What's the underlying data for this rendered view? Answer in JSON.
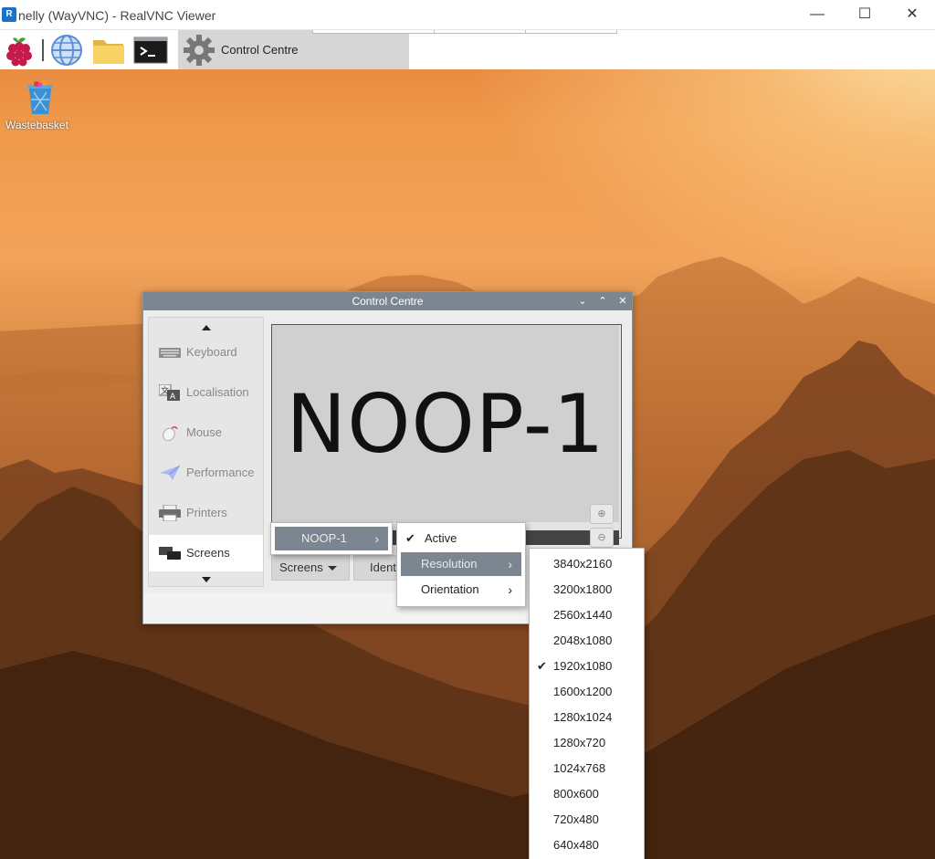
{
  "vnc_window": {
    "logo_text": "R",
    "title": "nelly (WayVNC) - RealVNC Viewer",
    "minimize_glyph": "—",
    "maximize_glyph": "☐",
    "close_glyph": "✕"
  },
  "taskbar": {
    "items": [
      {
        "name": "raspberry-menu",
        "icon": "raspberry-pi-icon"
      },
      {
        "name": "web-browser",
        "icon": "globe-icon"
      },
      {
        "name": "file-manager",
        "icon": "folder-icon"
      },
      {
        "name": "terminal",
        "icon": "terminal-icon"
      }
    ],
    "active_window": {
      "label": "Control Centre",
      "icon": "gear-icon"
    }
  },
  "desktop": {
    "icons": [
      {
        "label": "Wastebasket",
        "icon": "wastebasket-icon"
      }
    ]
  },
  "control_centre": {
    "title": "Control Centre",
    "titlebar_buttons": {
      "minimize": "⌄",
      "maximize": "⌃",
      "close": "✕"
    },
    "sidebar": {
      "items": [
        {
          "label": "Keyboard",
          "icon": "keyboard-icon",
          "selected": false
        },
        {
          "label": "Localisation",
          "icon": "localisation-icon",
          "selected": false
        },
        {
          "label": "Mouse",
          "icon": "mouse-icon",
          "selected": false
        },
        {
          "label": "Performance",
          "icon": "performance-icon",
          "selected": false
        },
        {
          "label": "Printers",
          "icon": "printer-icon",
          "selected": false
        },
        {
          "label": "Screens",
          "icon": "screens-icon",
          "selected": true
        }
      ]
    },
    "screens": {
      "monitor_label": "NOOP-1",
      "zoom_in_glyph": "⊕",
      "zoom_out_glyph": "⊖",
      "screens_button": "Screens",
      "identify_button": "Ident"
    }
  },
  "menus": {
    "screen_menu": {
      "item": "NOOP-1",
      "chevron": "›"
    },
    "output_menu": {
      "items": [
        {
          "label": "Active",
          "checked": true,
          "submenu": false
        },
        {
          "label": "Resolution",
          "checked": false,
          "submenu": true,
          "highlighted": true
        },
        {
          "label": "Orientation",
          "checked": false,
          "submenu": true
        }
      ],
      "check_glyph": "✔",
      "chevron": "›"
    },
    "resolution_menu": {
      "items": [
        "3840x2160",
        "3200x1800",
        "2560x1440",
        "2048x1080",
        "1920x1080",
        "1600x1200",
        "1280x1024",
        "1280x720",
        "1024x768",
        "800x600",
        "720x480",
        "640x480"
      ],
      "selected": "1920x1080",
      "check_glyph": "✔"
    }
  },
  "colors": {
    "highlight": "#7b8690",
    "dialog_title": "#7b8690",
    "desktop_top": "#e5823a",
    "desktop_bottom": "#4a2912"
  }
}
